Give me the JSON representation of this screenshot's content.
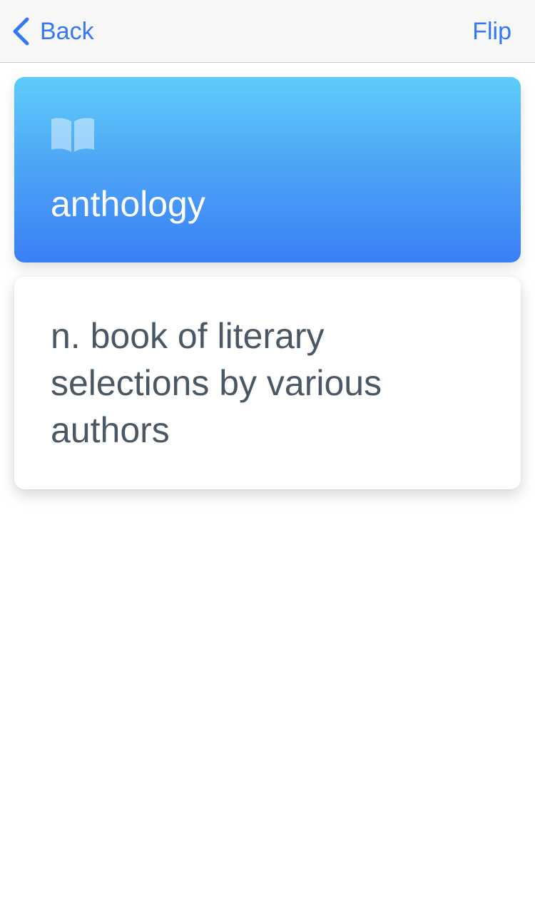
{
  "nav": {
    "back_label": "Back",
    "flip_label": "Flip"
  },
  "card": {
    "icon": "book-open-icon",
    "word": "anthology",
    "definition": "n. book of literary selections by various authors"
  },
  "colors": {
    "accent": "#3478f6",
    "card_gradient_top": "#5ecdf9",
    "card_gradient_bottom": "#3a7ff6",
    "definition_text": "#4a5866"
  }
}
